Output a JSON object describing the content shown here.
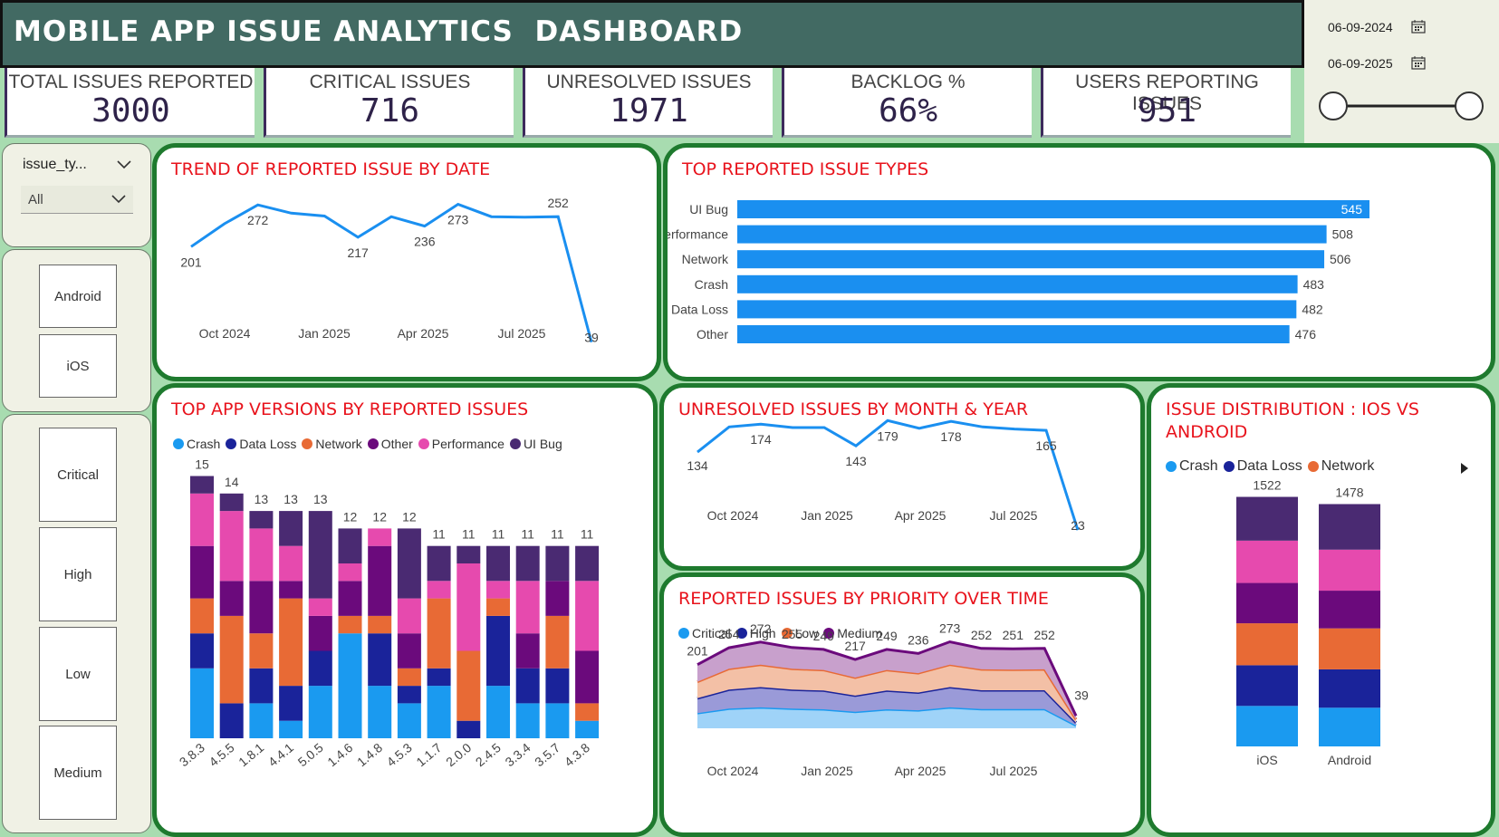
{
  "header": {
    "title": "MOBILE APP ISSUE ANALYTICS  DASHBOARD"
  },
  "date_range": {
    "start": "06-09-2024",
    "end": "06-09-2025"
  },
  "kpis": [
    {
      "label": "TOTAL ISSUES REPORTED",
      "value": "3000"
    },
    {
      "label": "CRITICAL ISSUES",
      "value": "716"
    },
    {
      "label": "UNRESOLVED ISSUES",
      "value": "1971"
    },
    {
      "label": "BACKLOG %",
      "value": "66%"
    },
    {
      "label": "USERS REPORTING ISSUES",
      "value": "951"
    }
  ],
  "filters": {
    "issue_type": {
      "label": "issue_ty...",
      "value": "All"
    },
    "platforms": [
      "Android",
      "iOS"
    ],
    "priorities": [
      "Critical",
      "High",
      "Low",
      "Medium"
    ]
  },
  "colors": {
    "Crash": "#1a9af0",
    "Data Loss": "#1a239a",
    "Network": "#e86a35",
    "Other": "#6b0a7c",
    "Performance": "#e64aae",
    "UI Bug": "#4a2a72",
    "Critical": "#1a9af0",
    "High": "#1a239a",
    "Low": "#e86a35",
    "Medium": "#6b0a7c",
    "bar": "#1a8ff0",
    "title_red": "#e8131c",
    "card_border": "#1e7a2e"
  },
  "chart_data": [
    {
      "id": "trend",
      "type": "line",
      "title": "TREND OF REPORTED ISSUE BY DATE",
      "values": [
        201,
        240,
        272,
        258,
        253,
        217,
        252,
        236,
        273,
        252,
        251,
        252,
        39
      ],
      "point_labels": [
        "201",
        "",
        "272",
        "",
        "",
        "217",
        "",
        "236",
        "273",
        "",
        "",
        "252",
        "39"
      ],
      "xticks": [
        "Oct 2024",
        "Jan 2025",
        "Apr 2025",
        "Jul 2025"
      ],
      "ylim": [
        0,
        300
      ]
    },
    {
      "id": "top_types",
      "type": "bar",
      "title": "TOP REPORTED ISSUE TYPES",
      "categories": [
        "UI Bug",
        "Performance",
        "Network",
        "Crash",
        "Data Loss",
        "Other"
      ],
      "values": [
        545,
        508,
        506,
        483,
        482,
        476
      ]
    },
    {
      "id": "versions",
      "type": "bar",
      "title": "TOP APP VERSIONS BY REPORTED ISSUES",
      "stacked": true,
      "legend": [
        "Crash",
        "Data Loss",
        "Network",
        "Other",
        "Performance",
        "UI Bug"
      ],
      "categories": [
        "3.8.3",
        "4.5.5",
        "1.8.1",
        "4.4.1",
        "5.0.5",
        "1.4.6",
        "1.4.8",
        "4.5.3",
        "1.1.7",
        "2.0.0",
        "2.4.5",
        "3.3.4",
        "3.5.7",
        "4.3.8"
      ],
      "totals": [
        15,
        14,
        13,
        13,
        13,
        12,
        12,
        12,
        11,
        11,
        11,
        11,
        11,
        11
      ],
      "series": [
        {
          "name": "Crash",
          "values": [
            4,
            0,
            2,
            1,
            3,
            6,
            3,
            2,
            3,
            0,
            3,
            2,
            2,
            1
          ]
        },
        {
          "name": "Data Loss",
          "values": [
            2,
            2,
            2,
            2,
            2,
            0,
            3,
            1,
            1,
            1,
            4,
            2,
            2,
            0
          ]
        },
        {
          "name": "Network",
          "values": [
            2,
            5,
            2,
            5,
            0,
            1,
            1,
            1,
            4,
            4,
            1,
            0,
            3,
            1
          ]
        },
        {
          "name": "Other",
          "values": [
            3,
            2,
            3,
            1,
            2,
            2,
            4,
            2,
            0,
            0,
            0,
            2,
            2,
            3
          ]
        },
        {
          "name": "Performance",
          "values": [
            3,
            4,
            3,
            2,
            1,
            1,
            1,
            2,
            1,
            5,
            1,
            3,
            0,
            4
          ]
        },
        {
          "name": "UI Bug",
          "values": [
            1,
            1,
            1,
            2,
            5,
            2,
            0,
            4,
            2,
            1,
            2,
            2,
            2,
            2
          ]
        }
      ],
      "ylim": [
        0,
        16
      ]
    },
    {
      "id": "unresolved",
      "type": "line",
      "title": "UNRESOLVED ISSUES BY MONTH & YEAR",
      "values": [
        134,
        170,
        174,
        169,
        169,
        143,
        179,
        168,
        178,
        170,
        167,
        165,
        23
      ],
      "point_labels": [
        "134",
        "",
        "174",
        "",
        "",
        "143",
        "179",
        "",
        "178",
        "",
        "",
        "165",
        "23"
      ],
      "xticks": [
        "Oct 2024",
        "Jan 2025",
        "Apr 2025",
        "Jul 2025"
      ],
      "ylim": [
        0,
        200
      ]
    },
    {
      "id": "distribution",
      "type": "bar",
      "title": "ISSUE DISTRIBUTION : IOS VS ANDROID",
      "stacked": true,
      "legend": [
        "Crash",
        "Data Loss",
        "Network"
      ],
      "categories": [
        "iOS",
        "Android"
      ],
      "totals": [
        1522,
        1478
      ],
      "series": [
        {
          "name": "Crash",
          "values": [
            247,
            236
          ]
        },
        {
          "name": "Data Loss",
          "values": [
            248,
            234
          ]
        },
        {
          "name": "Network",
          "values": [
            256,
            250
          ]
        },
        {
          "name": "Other",
          "values": [
            246,
            230
          ]
        },
        {
          "name": "Performance",
          "values": [
            258,
            250
          ]
        },
        {
          "name": "UI Bug",
          "values": [
            267,
            278
          ]
        }
      ],
      "ylim": [
        0,
        1600
      ]
    },
    {
      "id": "priority",
      "type": "area",
      "title": "REPORTED ISSUES BY PRIORITY OVER TIME",
      "stacked": true,
      "legend": [
        "Critical",
        "High",
        "Low",
        "Medium"
      ],
      "totals": [
        201,
        254,
        272,
        255,
        249,
        217,
        249,
        236,
        273,
        252,
        251,
        252,
        39
      ],
      "series": [
        {
          "name": "Critical",
          "values": [
            48,
            62,
            66,
            62,
            60,
            52,
            60,
            57,
            66,
            61,
            61,
            61,
            9
          ]
        },
        {
          "name": "High",
          "values": [
            47,
            60,
            64,
            60,
            59,
            51,
            59,
            56,
            64,
            59,
            59,
            59,
            9
          ]
        },
        {
          "name": "Low",
          "values": [
            52,
            66,
            71,
            66,
            65,
            57,
            65,
            61,
            71,
            66,
            65,
            66,
            10
          ]
        },
        {
          "name": "Medium",
          "values": [
            54,
            66,
            71,
            67,
            65,
            57,
            65,
            62,
            72,
            66,
            66,
            66,
            11
          ]
        }
      ],
      "xticks": [
        "Oct 2024",
        "Jan 2025",
        "Apr 2025",
        "Jul 2025"
      ],
      "ylim": [
        0,
        300
      ]
    }
  ]
}
